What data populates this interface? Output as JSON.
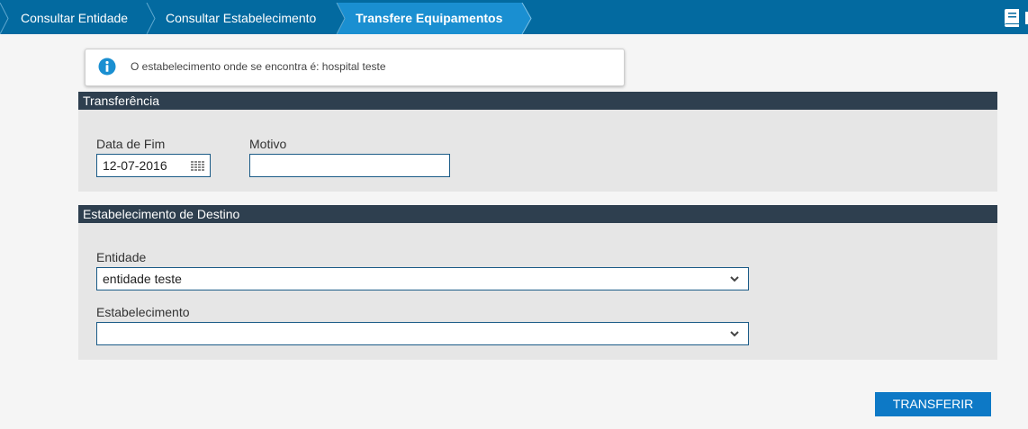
{
  "breadcrumb": {
    "items": [
      {
        "label": "Consultar Entidade"
      },
      {
        "label": "Consultar Estabelecimento"
      },
      {
        "label": "Transfere Equipamentos"
      }
    ]
  },
  "header": {
    "manual_icon": "book-icon"
  },
  "alert": {
    "icon": "info-icon",
    "message": "O estabelecimento onde se encontra é: hospital teste"
  },
  "transferencia": {
    "title": "Transferência",
    "data_fim": {
      "label": "Data de Fim",
      "value": "12-07-2016",
      "icon": "calendar-icon"
    },
    "motivo": {
      "label": "Motivo",
      "value": ""
    }
  },
  "destino": {
    "title": "Estabelecimento de Destino",
    "entidade": {
      "label": "Entidade",
      "selected": "entidade teste"
    },
    "estabelecimento": {
      "label": "Estabelecimento",
      "selected": ""
    }
  },
  "actions": {
    "transferir_label": "TRANSFERIR"
  },
  "colors": {
    "topbar": "#036aa0",
    "active_crumb": "#1a8fd1",
    "panel_header": "#2e3f4f",
    "panel_bg": "#e6e6e6",
    "button": "#0d79c6"
  }
}
